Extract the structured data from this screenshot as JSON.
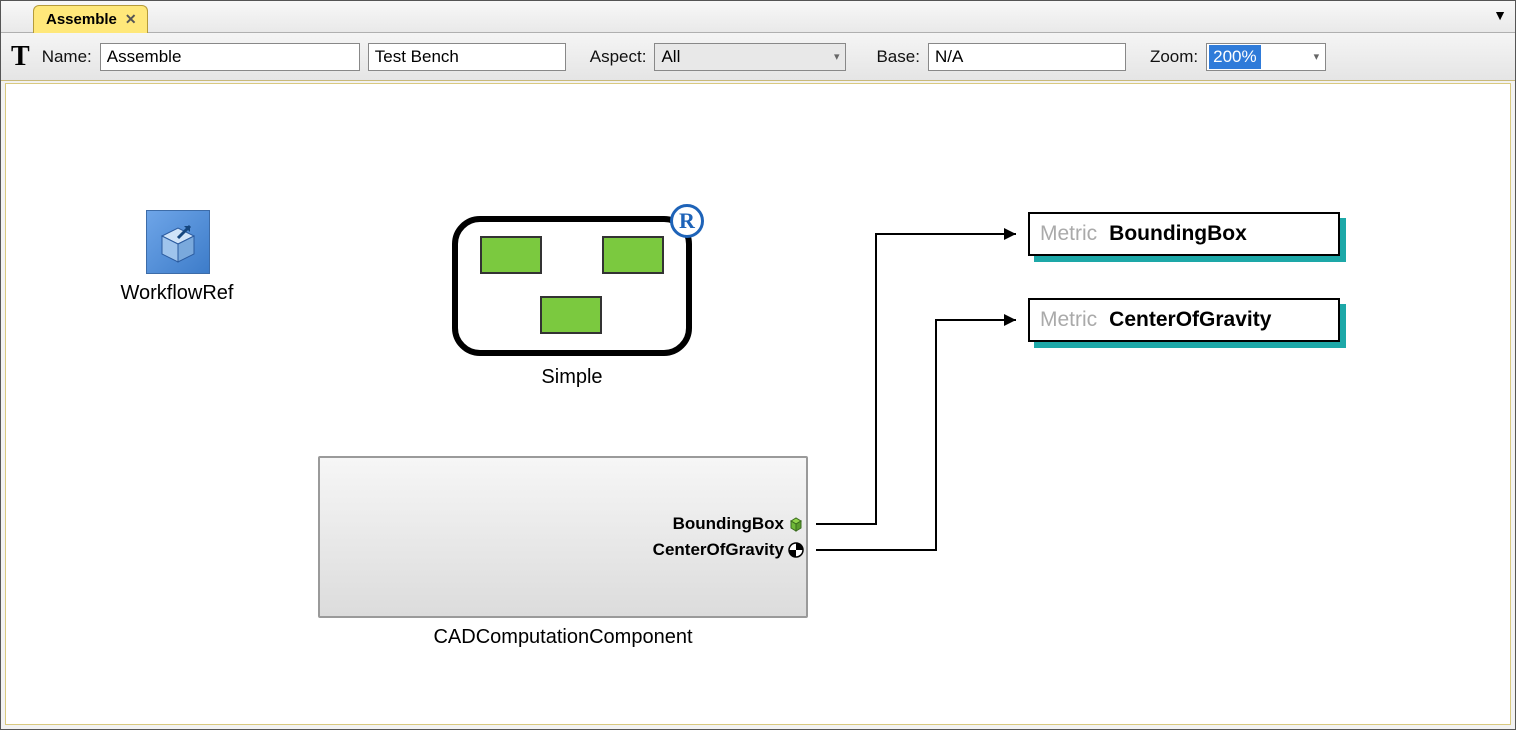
{
  "tab": {
    "title": "Assemble"
  },
  "toolbar": {
    "name_label": "Name:",
    "name_value": "Assemble",
    "type_value": "Test Bench",
    "aspect_label": "Aspect:",
    "aspect_value": "All",
    "base_label": "Base:",
    "base_value": "N/A",
    "zoom_label": "Zoom:",
    "zoom_value": "200%"
  },
  "nodes": {
    "workflowref_label": "WorkflowRef",
    "simple_label": "Simple",
    "cad_label": "CADComputationComponent",
    "ports": {
      "bb": "BoundingBox",
      "cog": "CenterOfGravity"
    }
  },
  "metrics": {
    "prefix": "Metric",
    "bb": "BoundingBox",
    "cog": "CenterOfGravity"
  }
}
